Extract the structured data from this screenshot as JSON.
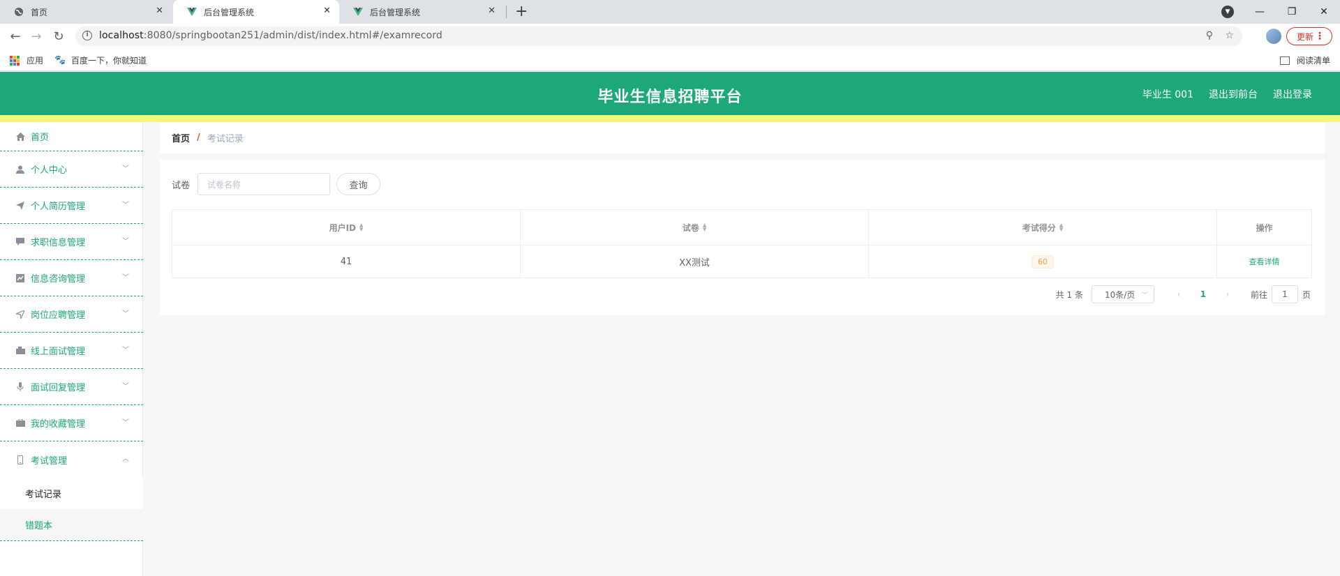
{
  "browser": {
    "tabs": [
      {
        "title": "首页",
        "active": false
      },
      {
        "title": "后台管理系统",
        "active": true
      },
      {
        "title": "后台管理系统",
        "active": false
      }
    ],
    "url_host": "localhost",
    "url_path": ":8080/springbootan251/admin/dist/index.html#/examrecord",
    "update_label": "更新",
    "bookmarks": [
      {
        "label": "应用",
        "icon": "apps-grid-icon"
      },
      {
        "label": "百度一下，你就知道",
        "icon": "baidu-paw-icon"
      }
    ],
    "reading_list": "阅读清单"
  },
  "header": {
    "title": "毕业生信息招聘平台",
    "user": "毕业生 001",
    "to_front": "退出到前台",
    "logout": "退出登录",
    "colors": {
      "primary": "#1ca878",
      "accent_bar": "#f6f57c"
    }
  },
  "sidebar": {
    "items": [
      {
        "label": "首页",
        "icon": "home-icon"
      },
      {
        "label": "个人中心",
        "icon": "user-icon"
      },
      {
        "label": "个人简历管理",
        "icon": "send-icon"
      },
      {
        "label": "求职信息管理",
        "icon": "chat-icon"
      },
      {
        "label": "信息咨询管理",
        "icon": "chart-icon"
      },
      {
        "label": "岗位应聘管理",
        "icon": "location-icon"
      },
      {
        "label": "线上面试管理",
        "icon": "camera-icon"
      },
      {
        "label": "面试回复管理",
        "icon": "microphone-icon"
      },
      {
        "label": "我的收藏管理",
        "icon": "briefcase-icon"
      },
      {
        "label": "考试管理",
        "icon": "mobile-icon"
      }
    ],
    "submenu": [
      {
        "label": "考试记录",
        "active": true
      },
      {
        "label": "错题本",
        "active": false
      }
    ]
  },
  "breadcrumb": {
    "home": "首页",
    "separator": "/",
    "current": "考试记录"
  },
  "search": {
    "label": "试卷",
    "placeholder": "试卷名称",
    "button": "查询"
  },
  "table": {
    "headers": [
      "用户ID",
      "试卷",
      "考试得分",
      "操作"
    ],
    "rows": [
      {
        "user_id": "41",
        "paper": "XX测试",
        "score": "60",
        "action": "查看详情"
      }
    ]
  },
  "pagination": {
    "total": "共 1 条",
    "page_size": "10条/页",
    "current_page": "1",
    "goto_prefix": "前往",
    "goto_value": "1",
    "goto_suffix": "页"
  }
}
